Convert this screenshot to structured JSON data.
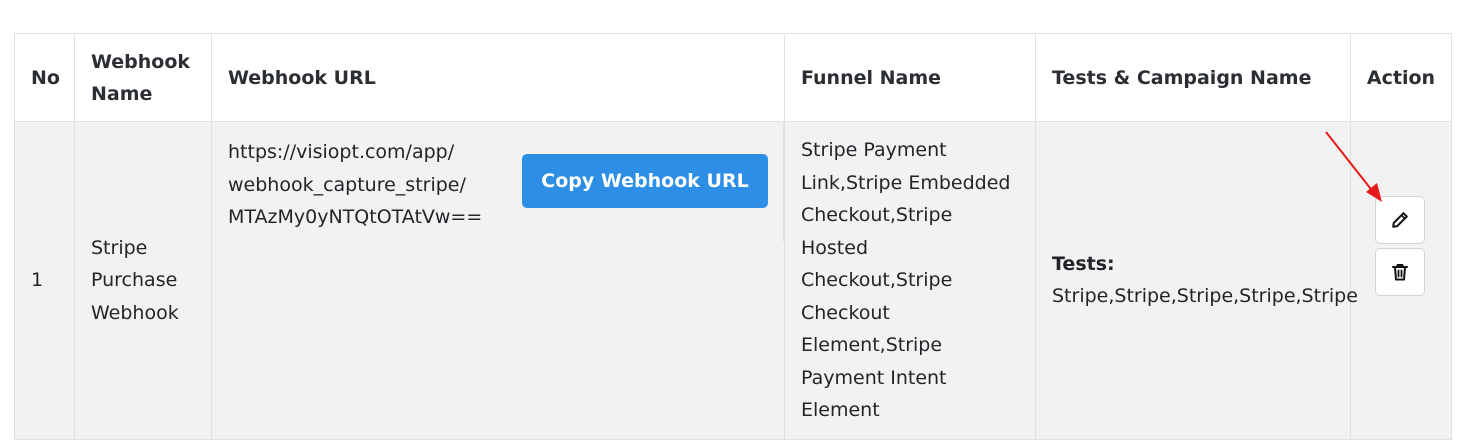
{
  "table": {
    "headers": {
      "no": "No",
      "webhook_name": "Webhook Name",
      "webhook_url": "Webhook URL",
      "funnel_name": "Funnel Name",
      "tests_campaign": "Tests & Campaign Name",
      "action": "Action"
    },
    "rows": [
      {
        "no": "1",
        "webhook_name": "Stripe Purchase Webhook",
        "webhook_url_lines": [
          "https://visiopt.com/app/",
          "webhook_capture_stripe/",
          "MTAzMy0yNTQtOTAtVw=="
        ],
        "copy_button_label": "Copy Webhook URL",
        "funnel_name": "Stripe Payment Link,Stripe Embedded Checkout,Stripe Hosted Checkout,Stripe Checkout Element,Stripe Payment Intent Element",
        "tests_label": "Tests:",
        "tests_value": "Stripe,Stripe,Stripe,Stripe,Stripe"
      }
    ]
  },
  "icons": {
    "edit": "pencil-icon",
    "delete": "trash-icon"
  },
  "colors": {
    "primary_button": "#2d8ee6",
    "row_background": "#f2f2f2",
    "annotation_arrow": "#e8191d"
  }
}
